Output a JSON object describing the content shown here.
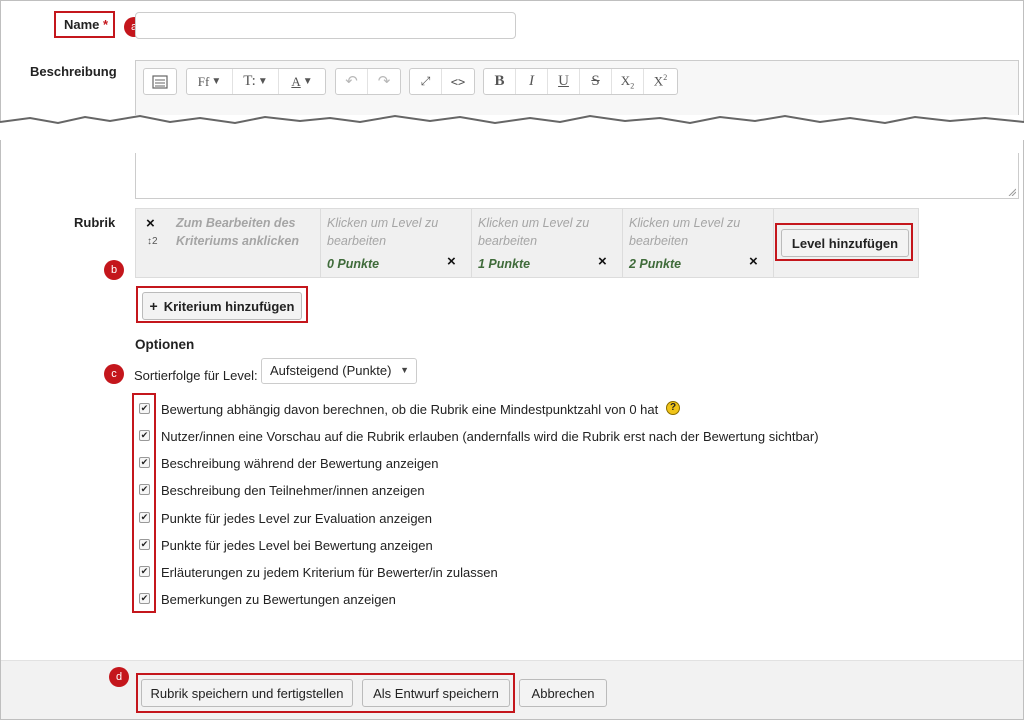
{
  "form": {
    "name_label": "Name",
    "required_mark": "*",
    "name_value": "",
    "description_label": "Beschreibung"
  },
  "markers": {
    "a": "a",
    "b": "b",
    "c": "c",
    "d": "d"
  },
  "editor": {
    "toolbar": {
      "font_family": "Ff",
      "font_size": "T:",
      "text_color": "A",
      "bold": "B",
      "italic": "I",
      "underline": "U",
      "strike": "S"
    }
  },
  "rubric": {
    "label": "Rubrik",
    "criterion_delete": "×",
    "criterion_move": "↕2",
    "criterion_placeholder": "Zum Bearbeiten des Kriteriums anklicken",
    "levels": [
      {
        "placeholder": "Klicken um Level zu bearbeiten",
        "points": "0  Punkte"
      },
      {
        "placeholder": "Klicken um Level zu bearbeiten",
        "points": "1  Punkte"
      },
      {
        "placeholder": "Klicken um Level zu bearbeiten",
        "points": "2  Punkte"
      }
    ],
    "level_delete": "×",
    "add_level": "Level hinzufügen",
    "add_criterion_icon": "+",
    "add_criterion": "Kriterium hinzufügen"
  },
  "options": {
    "heading": "Optionen",
    "sort_label": "Sortierfolge für Level:",
    "sort_value": "Aufsteigend (Punkte)",
    "checkboxes": [
      {
        "label": "Bewertung abhängig davon berechnen, ob die Rubrik eine Mindestpunktzahl von 0 hat",
        "checked": true,
        "help": "?"
      },
      {
        "label": "Nutzer/innen eine Vorschau auf die Rubrik erlauben (andernfalls wird die Rubrik erst nach der Bewertung sichtbar)",
        "checked": true
      },
      {
        "label": "Beschreibung während der Bewertung anzeigen",
        "checked": true
      },
      {
        "label": "Beschreibung den Teilnehmer/innen anzeigen",
        "checked": true
      },
      {
        "label": "Punkte für jedes Level zur Evaluation anzeigen",
        "checked": true
      },
      {
        "label": "Punkte für jedes Level bei Bewertung anzeigen",
        "checked": true
      },
      {
        "label": "Erläuterungen zu jedem Kriterium für Bewerter/in zulassen",
        "checked": true
      },
      {
        "label": "Bemerkungen zu Bewertungen anzeigen",
        "checked": true
      }
    ]
  },
  "footer": {
    "save_finish": "Rubrik speichern und fertigstellen",
    "save_draft": "Als Entwurf speichern",
    "cancel": "Abbrechen"
  },
  "colors": {
    "accent_red": "#c4161c",
    "points_green": "#3f6b3a"
  }
}
